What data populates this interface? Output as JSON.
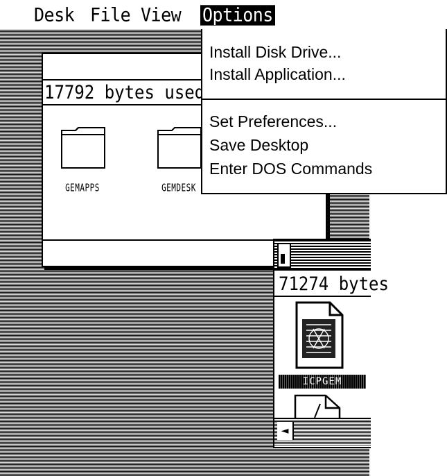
{
  "menubar": {
    "items": [
      {
        "id": "desk",
        "label": "Desk"
      },
      {
        "id": "file",
        "label": "File"
      },
      {
        "id": "view",
        "label": "View"
      },
      {
        "id": "options",
        "label": "Options",
        "active": true
      }
    ]
  },
  "options_menu": {
    "group1": [
      "Install Disk Drive...",
      "Install Application..."
    ],
    "group2": [
      "Set Preferences...",
      "Save Desktop",
      "Enter DOS Commands"
    ]
  },
  "window1": {
    "info": "17792 bytes used",
    "folders": [
      {
        "label": "GEMAPPS",
        "icon": "folder-icon"
      },
      {
        "label": "GEMDESK",
        "icon": "folder-icon"
      }
    ]
  },
  "window2": {
    "info": "71274 bytes",
    "items": [
      {
        "label": "ICPGEM",
        "icon": "application-icon",
        "selected": true
      },
      {
        "label": "",
        "icon": "document-icon"
      }
    ]
  },
  "colors": {
    "foreground": "#000000",
    "background": "#ffffff",
    "selection": "#000000"
  }
}
